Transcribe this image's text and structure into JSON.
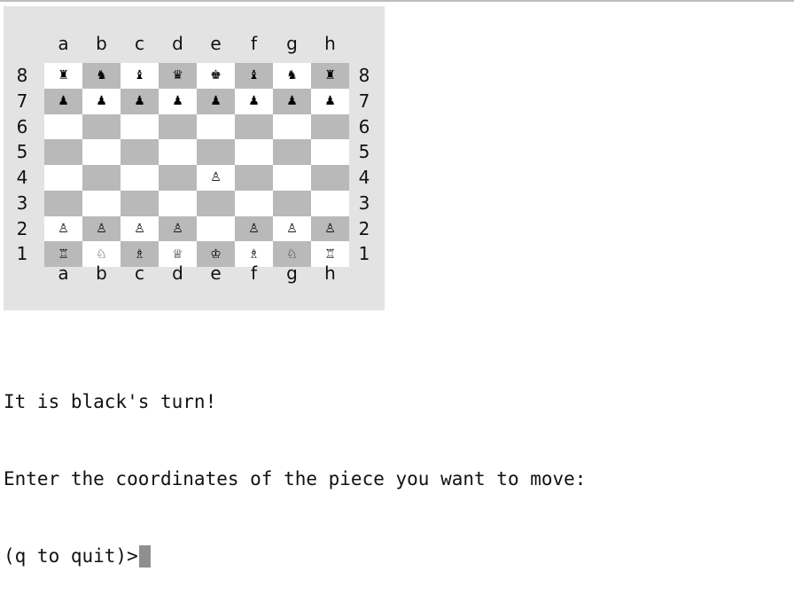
{
  "board": {
    "files": [
      "a",
      "b",
      "c",
      "d",
      "e",
      "f",
      "g",
      "h"
    ],
    "ranks": [
      "8",
      "7",
      "6",
      "5",
      "4",
      "3",
      "2",
      "1"
    ],
    "colors": {
      "light": "#ffffff",
      "dark": "#b9b9b9",
      "panel": "#e3e3e3"
    },
    "pieces": {
      "a8": "♜",
      "b8": "♞",
      "c8": "♝",
      "d8": "♛",
      "e8": "♚",
      "f8": "♝",
      "g8": "♞",
      "h8": "♜",
      "a7": "♟",
      "b7": "♟",
      "c7": "♟",
      "d7": "♟",
      "e7": "♟",
      "f7": "♟",
      "g7": "♟",
      "h7": "♟",
      "e4": "♙",
      "a2": "♙",
      "b2": "♙",
      "c2": "♙",
      "d2": "♙",
      "f2": "♙",
      "g2": "♙",
      "h2": "♙",
      "a1": "♖",
      "b1": "♘",
      "c1": "♗",
      "d1": "♕",
      "e1": "♔",
      "f1": "♗",
      "g1": "♘",
      "h1": "♖"
    }
  },
  "console": {
    "line1": "It is black's turn!",
    "line2": "Enter the coordinates of the piece you want to move:",
    "prompt": "(q to quit)>"
  }
}
